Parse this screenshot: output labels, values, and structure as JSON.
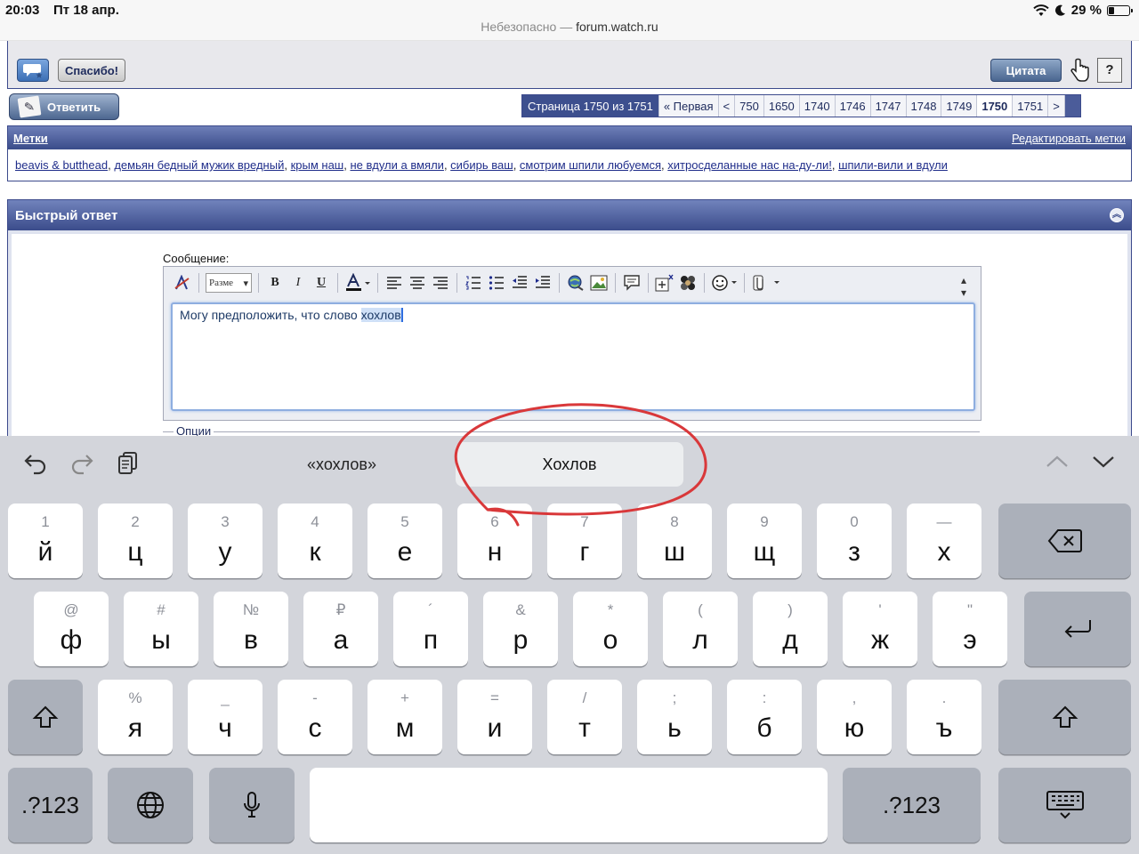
{
  "status": {
    "time": "20:03",
    "date": "Пт 18 апр.",
    "battery": "29 %",
    "battery_level": 0.29,
    "url_prefix": "Небезопасно — ",
    "url_host": "forum.watch.ru"
  },
  "postbar": {
    "thanks_label": "Спасибо!",
    "quote_label": "Цитата",
    "qa_label": "?"
  },
  "reply_button": "Ответить",
  "pager": {
    "info": "Страница 1750 из 1751",
    "first": "« Первая",
    "prev": "<",
    "pages": [
      "750",
      "1650",
      "1740",
      "1746",
      "1747",
      "1748",
      "1749",
      "1750",
      "1751"
    ],
    "current": "1750",
    "next": ">"
  },
  "tags": {
    "title": "Метки",
    "edit_label": "Редактировать метки",
    "items": [
      "beavis & butthead",
      "демьян бедный мужик вредный",
      "крым наш",
      "не вдули а вмяли",
      "сибирь ваш",
      "смотрим шпили любуемся",
      "хитросделанные нас на-ду-ли!",
      "шпили-вили и вдули"
    ]
  },
  "quick_reply": {
    "title": "Быстрый ответ",
    "message_label": "Сообщение:",
    "size_select": "Разме",
    "text_before": "Могу предположить, что слово ",
    "text_selected": "хохлов",
    "options_label": "Опции"
  },
  "keyboard": {
    "predictions": [
      "«хохлов»",
      "Хохлов"
    ],
    "row1": [
      {
        "hint": "1",
        "key": "й"
      },
      {
        "hint": "2",
        "key": "ц"
      },
      {
        "hint": "3",
        "key": "у"
      },
      {
        "hint": "4",
        "key": "к"
      },
      {
        "hint": "5",
        "key": "е"
      },
      {
        "hint": "6",
        "key": "н"
      },
      {
        "hint": "7",
        "key": "г"
      },
      {
        "hint": "8",
        "key": "ш"
      },
      {
        "hint": "9",
        "key": "щ"
      },
      {
        "hint": "0",
        "key": "з"
      },
      {
        "hint": "—",
        "key": "х"
      }
    ],
    "row2": [
      {
        "hint": "@",
        "key": "ф"
      },
      {
        "hint": "#",
        "key": "ы"
      },
      {
        "hint": "№",
        "key": "в"
      },
      {
        "hint": "₽",
        "key": "а"
      },
      {
        "hint": "´",
        "key": "п"
      },
      {
        "hint": "&",
        "key": "р"
      },
      {
        "hint": "*",
        "key": "о"
      },
      {
        "hint": "(",
        "key": "л"
      },
      {
        "hint": ")",
        "key": "д"
      },
      {
        "hint": "'",
        "key": "ж"
      },
      {
        "hint": "\"",
        "key": "э"
      }
    ],
    "row3": [
      {
        "hint": "%",
        "key": "я"
      },
      {
        "hint": "_",
        "key": "ч"
      },
      {
        "hint": "-",
        "key": "с"
      },
      {
        "hint": "+",
        "key": "м"
      },
      {
        "hint": "=",
        "key": "и"
      },
      {
        "hint": "/",
        "key": "т"
      },
      {
        "hint": ";",
        "key": "ь"
      },
      {
        "hint": ":",
        "key": "б"
      },
      {
        "hint": ",",
        "key": "ю"
      },
      {
        "hint": ".",
        "key": "ъ"
      }
    ],
    "numbers_label": ".?123"
  },
  "colors": {
    "forum_blue": "#3c4a8c",
    "annotation_red": "#d9383a",
    "keyboard_bg": "#d3d5db"
  }
}
